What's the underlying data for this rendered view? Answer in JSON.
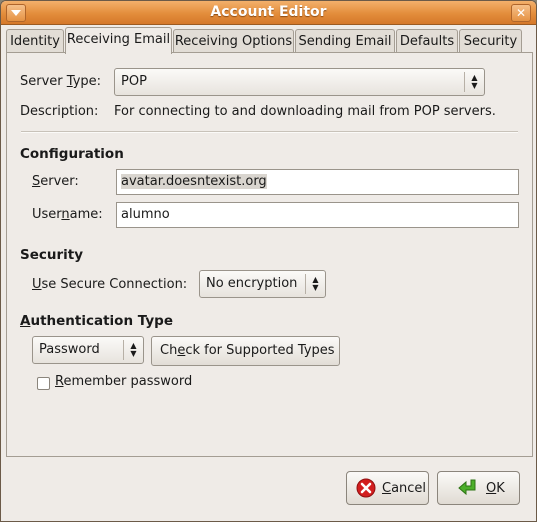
{
  "window": {
    "title": "Account Editor"
  },
  "tabs": [
    {
      "label": "Identity"
    },
    {
      "label": "Receiving Email"
    },
    {
      "label": "Receiving Options"
    },
    {
      "label": "Sending Email"
    },
    {
      "label": "Defaults"
    },
    {
      "label": "Security"
    }
  ],
  "server_type": {
    "label_pre": "Server ",
    "label_mnemonic": "T",
    "label_post": "ype:",
    "value": "POP",
    "description_label": "Description:",
    "description": "For connecting to and downloading mail from POP servers."
  },
  "configuration": {
    "heading": "Configuration",
    "server_label_mnemonic": "S",
    "server_label_rest": "erver:",
    "server_value": "avatar.doesntexist.org",
    "username_label_pre": "User",
    "username_label_mnemonic": "n",
    "username_label_post": "ame:",
    "username_value": "alumno"
  },
  "security": {
    "heading": "Security",
    "secure_label_mnemonic": "U",
    "secure_label_rest": "se Secure Connection:",
    "secure_value": "No encryption"
  },
  "authentication": {
    "heading_mnemonic": "A",
    "heading_rest": "uthentication Type",
    "type_value": "Password",
    "check_label_pre": "Ch",
    "check_label_mnemonic": "e",
    "check_label_post": "ck for Supported Types",
    "remember_label_mnemonic": "R",
    "remember_label_rest": "emember password",
    "remember_checked": false
  },
  "buttons": {
    "cancel_mnemonic": "C",
    "cancel_rest": "ancel",
    "ok_mnemonic": "O",
    "ok_rest": "K"
  },
  "icons": {
    "cancel": "cancel-icon",
    "ok": "ok-arrow-icon"
  },
  "colors": {
    "titlebar": "#e38d3b",
    "cancel_icon": "#d21f1f",
    "ok_icon": "#4caf2a"
  }
}
